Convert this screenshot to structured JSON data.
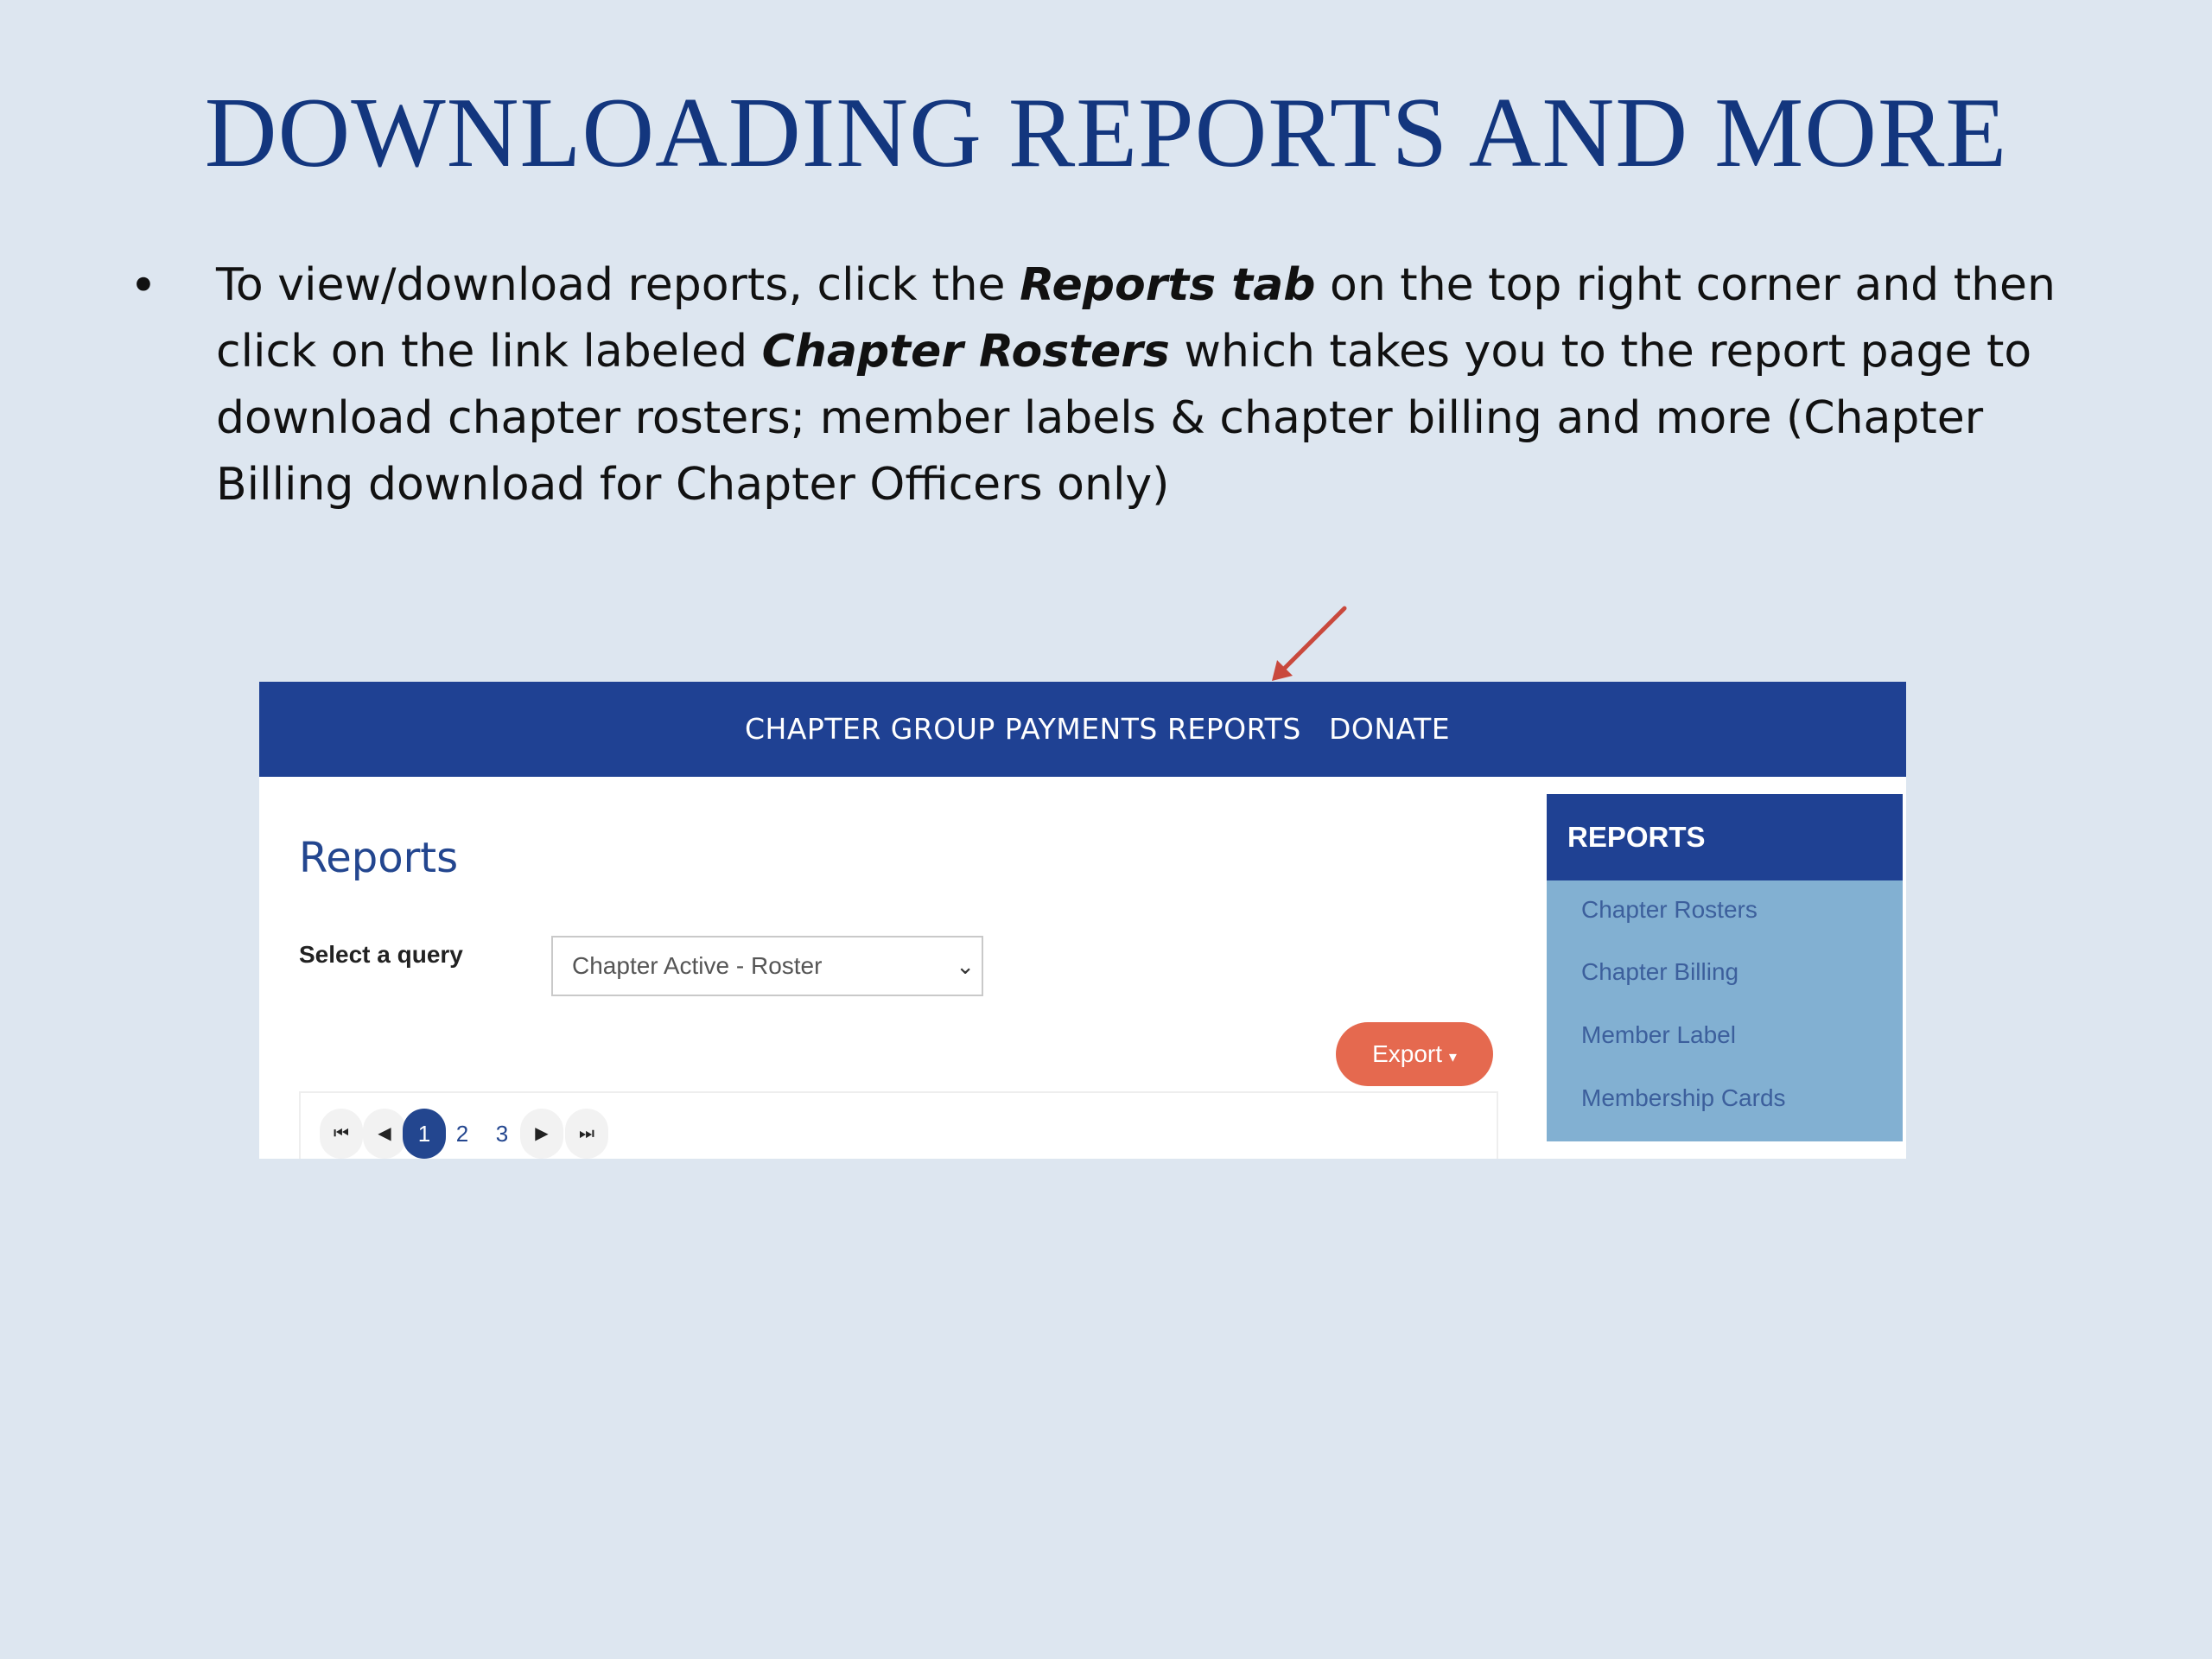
{
  "slide": {
    "title": "DOWNLOADING REPORTS AND MORE",
    "bullet": {
      "symbol": "•",
      "part1": "To view/download reports,  click the ",
      "em1": "Reports tab",
      "part2": " on the top right corner and then click on the link labeled ",
      "em2": "Chapter Rosters",
      "part3": " which takes you to the report page to download  chapter rosters; member labels & chapter billing and more (Chapter Billing download for Chapter Officers only)"
    }
  },
  "screenshot": {
    "nav": {
      "items": [
        "CHAPTER GROUP PAYMENTS",
        "REPORTS",
        "DONATE"
      ]
    },
    "main": {
      "heading": "Reports",
      "query_label": "Select a query",
      "query_value": "Chapter Active - Roster",
      "export_label": "Export",
      "pager": {
        "first": "⏮",
        "prev": "◀",
        "pages": [
          "1",
          "2",
          "3"
        ],
        "next": "▶",
        "last": "⏭"
      }
    },
    "sidebar": {
      "title": "REPORTS",
      "items": [
        "Chapter Rosters",
        "Chapter Billing",
        "Member Label",
        "Membership Cards"
      ]
    }
  },
  "colors": {
    "background": "#dde6f0",
    "title": "#13367e",
    "nav_bar": "#1f4193",
    "sidebar": "#82b0d2",
    "export_button": "#e5694f",
    "arrow": "#c9493d"
  },
  "icons": {
    "arrow": "red-arrow-pointer",
    "select": "chevron-down-icon",
    "export": "caret-down-icon"
  }
}
